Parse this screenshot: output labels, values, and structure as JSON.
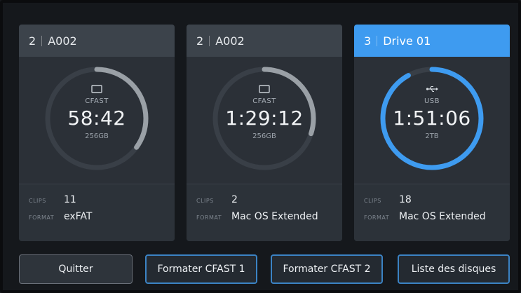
{
  "cards": [
    {
      "num": "2",
      "name": "A002",
      "media": "CFAST",
      "time": "58:42",
      "capacity": "256GB",
      "clips_label": "CLIPS",
      "clips": "11",
      "format_label": "FORMAT",
      "format": "exFAT",
      "icon": "card-icon",
      "ring_color": "#9aa0a6",
      "ring_fill": 0.35,
      "active": false
    },
    {
      "num": "2",
      "name": "A002",
      "media": "CFAST",
      "time": "1:29:12",
      "capacity": "256GB",
      "clips_label": "CLIPS",
      "clips": "2",
      "format_label": "FORMAT",
      "format": "Mac OS Extended",
      "icon": "card-icon",
      "ring_color": "#9aa0a6",
      "ring_fill": 0.3,
      "active": false
    },
    {
      "num": "3",
      "name": "Drive 01",
      "media": "USB",
      "time": "1:51:06",
      "capacity": "2TB",
      "clips_label": "CLIPS",
      "clips": "18",
      "format_label": "FORMAT",
      "format": "Mac OS Extended",
      "icon": "usb-icon",
      "ring_color": "#3e9bf0",
      "ring_fill": 0.92,
      "active": true
    }
  ],
  "buttons": {
    "quit": "Quitter",
    "format1": "Formater CFAST 1",
    "format2": "Formater CFAST 2",
    "disk_list": "Liste des disques"
  },
  "colors": {
    "accent": "#3e9bf0",
    "track": "#393f47",
    "ring_gray": "#9aa0a6"
  }
}
